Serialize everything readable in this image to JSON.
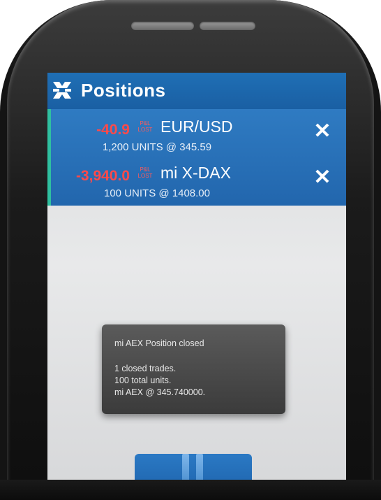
{
  "header": {
    "title": "Positions",
    "logo": "bank-logo-icon"
  },
  "positions": [
    {
      "pl": "-40.9",
      "badge_top": "P&L",
      "badge_bottom": "LOST",
      "symbol": "EUR/USD",
      "units": "1,200 UNITS @ 345.59",
      "close": "✕"
    },
    {
      "pl": "-3,940.0",
      "badge_top": "P&L",
      "badge_bottom": "LOST",
      "symbol": "mi X-DAX",
      "units": "100 UNITS @ 1408.00",
      "close": "✕"
    }
  ],
  "toast": {
    "title": "mi AEX Position closed",
    "line1": "1 closed trades.",
    "line2": "100 total units.",
    "line3": "mi AEX @ 345.740000."
  },
  "bottom": {
    "icon": "pause-icon"
  },
  "colors": {
    "header": "#1f6fb5",
    "list": "#2a72b8",
    "loss": "#ff4a4a",
    "accent": "#2fc0a0"
  }
}
